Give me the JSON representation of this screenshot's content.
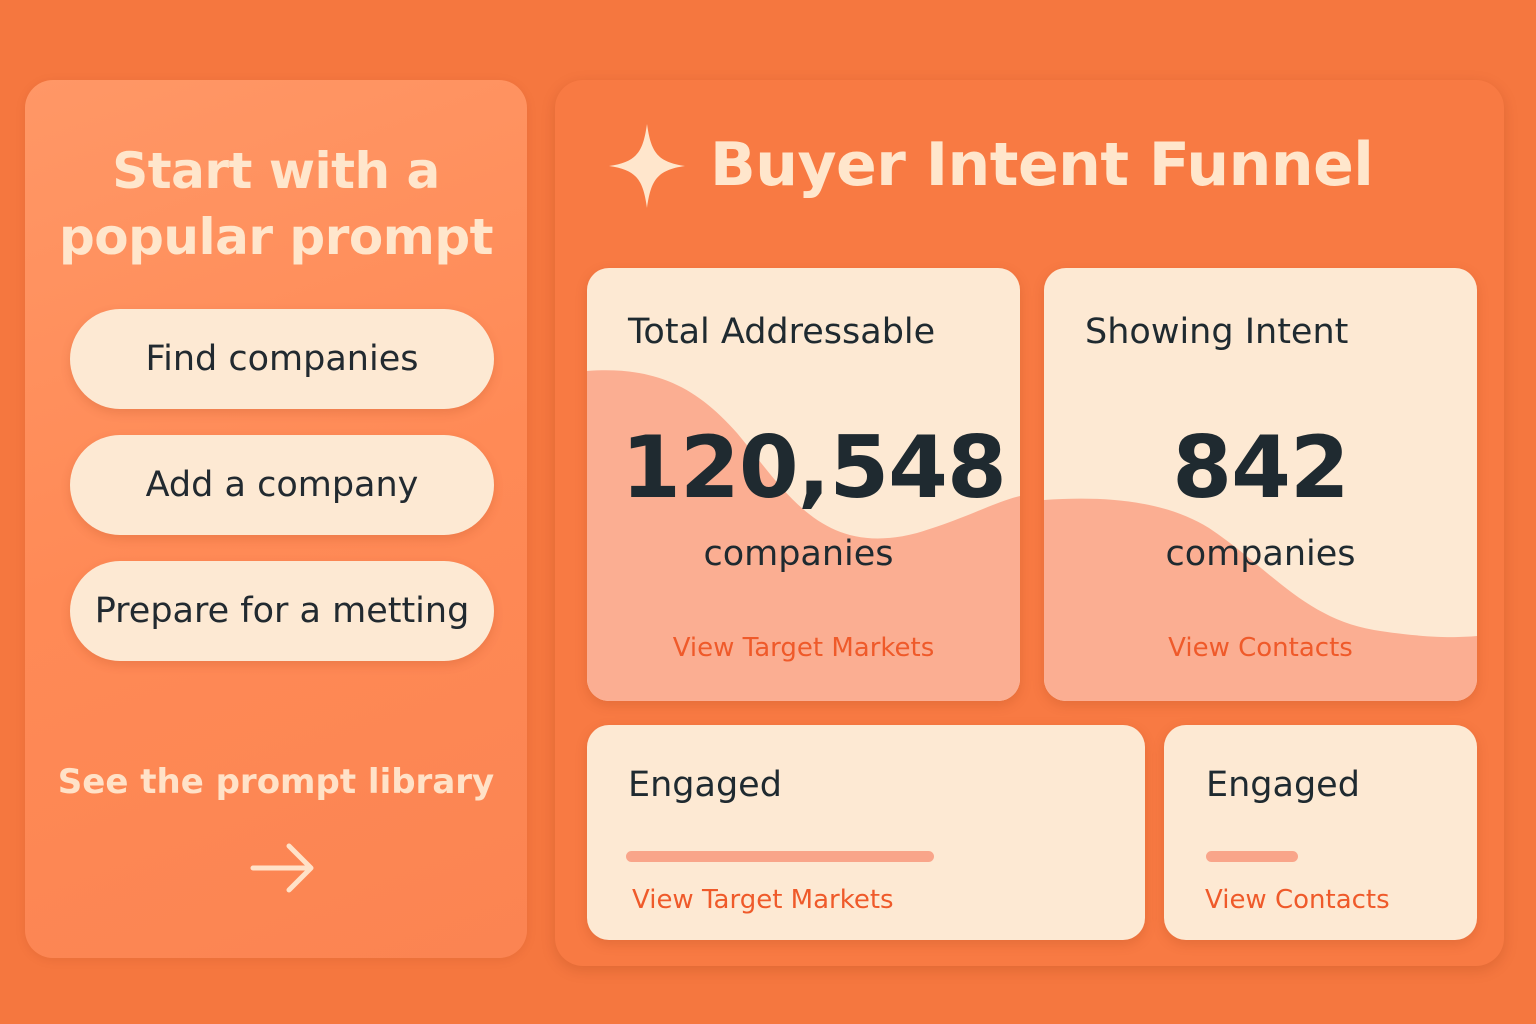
{
  "prompts": {
    "title_line1": "Start with a",
    "title_line2": "popular prompt",
    "items": [
      {
        "label": "Find companies"
      },
      {
        "label": "Add a company"
      },
      {
        "label": "Prepare for a metting"
      }
    ],
    "library_link": "See the prompt library",
    "library_icon": "arrow-right-icon"
  },
  "funnel": {
    "title": "Buyer Intent  Funnel",
    "title_icon": "sparkle-icon",
    "cards": [
      {
        "label": "Total Addressable",
        "value": "120,548",
        "unit": "companies",
        "link": "View Target Markets"
      },
      {
        "label": "Showing Intent",
        "value": "842",
        "unit": "companies",
        "link": "View Contacts"
      }
    ],
    "engaged": [
      {
        "label": "Engaged",
        "link": "View Target Markets"
      },
      {
        "label": "Engaged",
        "link": "View Contacts"
      }
    ]
  },
  "colors": {
    "background": "#f5773f",
    "card": "#fde9d3",
    "accent_link": "#ef5a2a",
    "wave": "#fbae92",
    "text_dark": "#1f2a30",
    "title_light": "#ffe6cc"
  }
}
